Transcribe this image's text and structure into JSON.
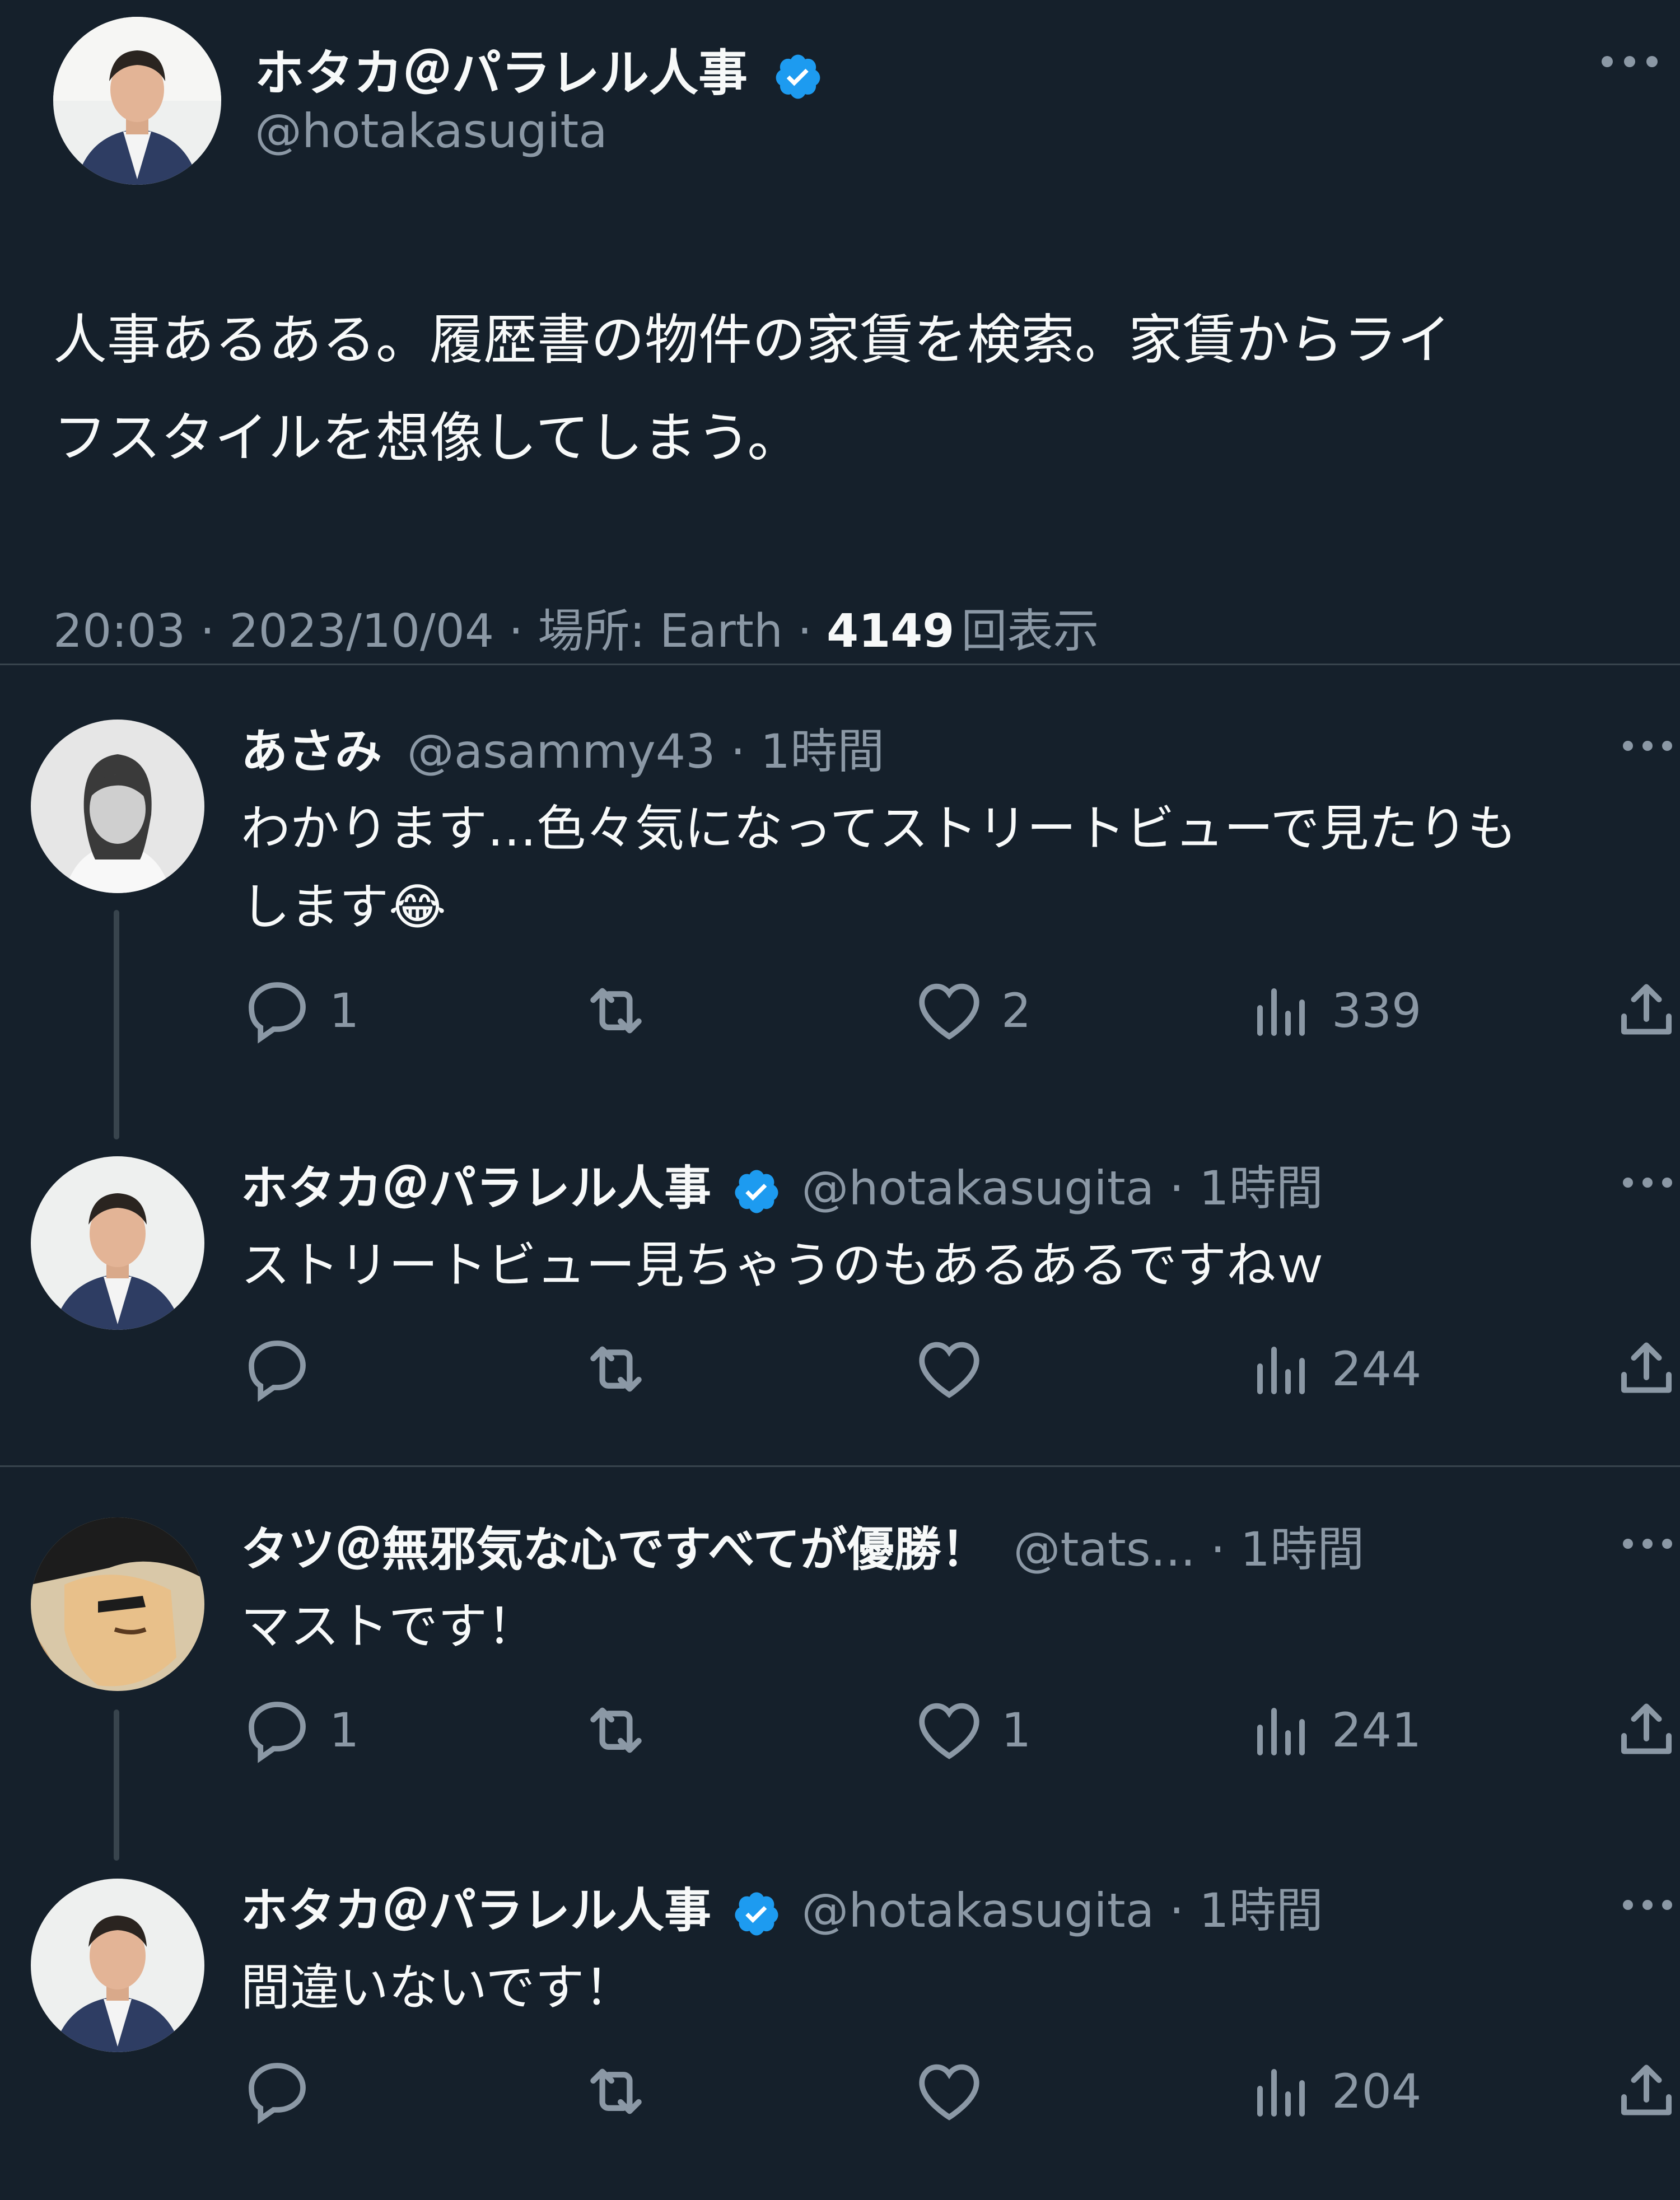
{
  "main_tweet": {
    "name": "ホタカ＠パラレル人事",
    "handle": "@hotakasugita",
    "text_line1": "人事あるある。履歴書の物件の家賃を検索。家賃からライ",
    "text_line2": "フスタイルを想像してしまう。",
    "time": "20:03",
    "date": "2023/10/04",
    "location": "場所: Earth",
    "views_count": "4149",
    "views_label": "回表示"
  },
  "replies": [
    {
      "name": "あさみ",
      "handle": "@asammy43",
      "time": "1時間",
      "text_line1": "わかります…色々気になってストリートビューで見たりも",
      "text_line2": "します",
      "emoji": "😂",
      "reply_count": "1",
      "retweet_count": "",
      "like_count": "2",
      "view_count": "339"
    },
    {
      "name": "ホタカ＠パラレル人事",
      "handle": "@hotakasugita",
      "time": "1時間",
      "text_line1": "ストリートビュー見ちゃうのもあるあるですねｗ",
      "reply_count": "",
      "retweet_count": "",
      "like_count": "",
      "view_count": "244"
    },
    {
      "name": "タツ＠無邪気な心ですべてが優勝！",
      "handle": "@tats...",
      "time": "1時間",
      "text_line1": "マストです！",
      "reply_count": "1",
      "retweet_count": "",
      "like_count": "1",
      "view_count": "241"
    },
    {
      "name": "ホタカ＠パラレル人事",
      "handle": "@hotakasugita",
      "time": "1時間",
      "text_line1": "間違いないです！",
      "reply_count": "",
      "retweet_count": "",
      "like_count": "",
      "view_count": "204"
    }
  ],
  "colors": {
    "background": "#15202b",
    "text": "#f7f9f9",
    "muted": "#8b98a5",
    "verified": "#1d9bf0",
    "divider": "#38444d"
  }
}
